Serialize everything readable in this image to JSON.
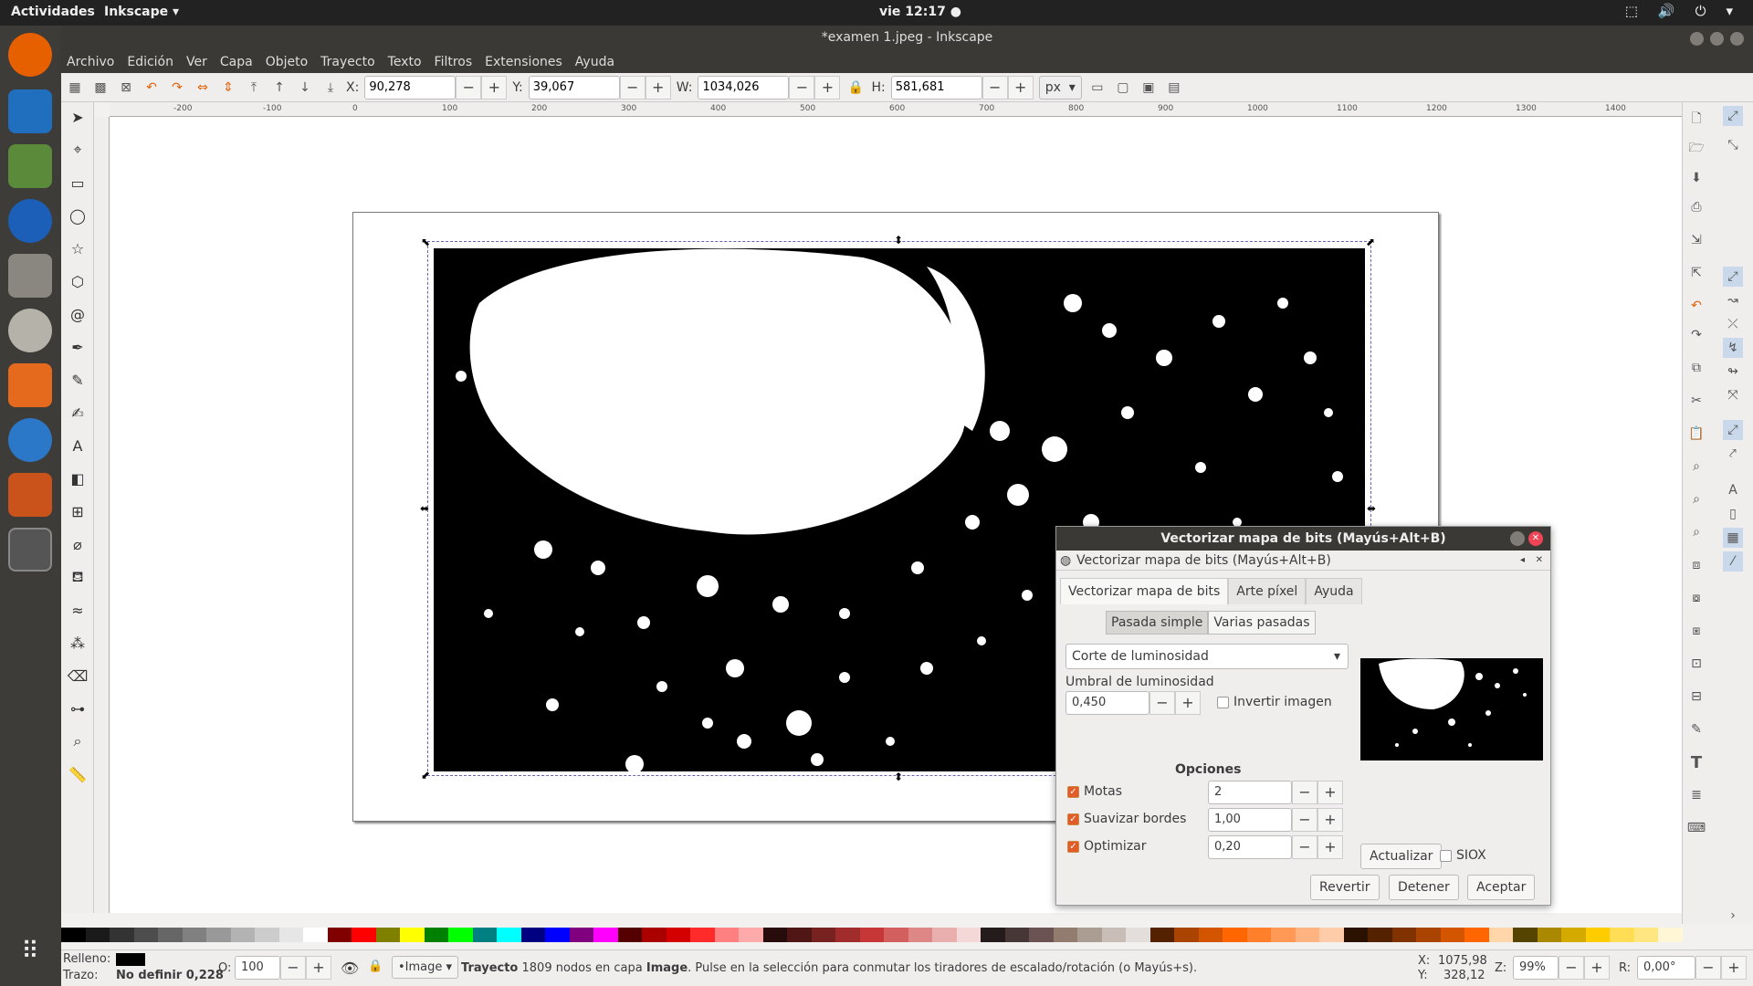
{
  "topbar": {
    "activities": "Actividades",
    "app": "Inkscape ▾",
    "clock": "vie 12:17 ●"
  },
  "window": {
    "title": "*examen 1.jpeg - Inkscape"
  },
  "menu": [
    "Archivo",
    "Edición",
    "Ver",
    "Capa",
    "Objeto",
    "Trayecto",
    "Texto",
    "Filtros",
    "Extensiones",
    "Ayuda"
  ],
  "controls": {
    "x_label": "X:",
    "x": "90,278",
    "y_label": "Y:",
    "y": "39,067",
    "w_label": "W:",
    "w": "1034,026",
    "h_label": "H:",
    "h": "581,681",
    "unit": "px"
  },
  "ruler": [
    "-200",
    "-100",
    "0",
    "100",
    "200",
    "300",
    "400",
    "500",
    "600",
    "700",
    "800",
    "900",
    "1000",
    "1100",
    "1200",
    "1300",
    "1400"
  ],
  "dialog": {
    "title": "Vectorizar mapa de bits (Mayús+Alt+B)",
    "subtitle": "Vectorizar mapa de bits (Mayús+Alt+B)",
    "tabs": [
      "Vectorizar mapa de bits",
      "Arte píxel",
      "Ayuda"
    ],
    "modes": [
      "Pasada simple",
      "Varias pasadas"
    ],
    "method": "Corte de luminosidad",
    "threshold_label": "Umbral de luminosidad",
    "threshold": "0,450",
    "invert_label": "Invertir imagen",
    "options_label": "Opciones",
    "speckles_label": "Motas",
    "speckles": "2",
    "smooth_label": "Suavizar bordes",
    "smooth": "1,00",
    "optimize_label": "Optimizar",
    "optimize": "0,20",
    "update": "Actualizar",
    "siox": "SIOX",
    "revert": "Revertir",
    "stop": "Detener",
    "ok": "Aceptar"
  },
  "status": {
    "fill_label": "Relleno:",
    "stroke_label": "Trazo:",
    "stroke_value": "No definir 0,228",
    "opacity_label": "O:",
    "opacity": "100",
    "layer": "•Image",
    "message_bold": "Trayecto",
    "message": " 1809 nodos en capa ",
    "message_layer": "Image",
    "message_rest": ". Pulse en la selección para conmutar los tiradores de escalado/rotación (o Mayús+s).",
    "cx_label": "X:",
    "cx": "1075,98",
    "cy_label": "Y:",
    "cy": "328,12",
    "zoom_label": "Z:",
    "zoom": "99%",
    "rot_label": "R:",
    "rot": "0,00°"
  },
  "palette": [
    "#000000",
    "#1a1a1a",
    "#333333",
    "#4d4d4d",
    "#666666",
    "#808080",
    "#999999",
    "#b3b3b3",
    "#cccccc",
    "#e6e6e6",
    "#ffffff",
    "#800000",
    "#ff0000",
    "#808000",
    "#ffff00",
    "#008000",
    "#00ff00",
    "#008080",
    "#00ffff",
    "#000080",
    "#0000ff",
    "#800080",
    "#ff00ff",
    "#550000",
    "#aa0000",
    "#d40000",
    "#ff2a2a",
    "#ff8080",
    "#ffaaaa",
    "#280b0b",
    "#501616",
    "#782121",
    "#a02c2c",
    "#c83737",
    "#d35f5f",
    "#de8787",
    "#e9afaf",
    "#f4d7d7",
    "#241c1c",
    "#483737",
    "#6c5353",
    "#917c6f",
    "#ac9d93",
    "#c8beb7",
    "#e3dedb",
    "#552200",
    "#aa4400",
    "#d45500",
    "#ff6600",
    "#ff7f2a",
    "#ff9955",
    "#ffb380",
    "#ffccaa",
    "#2b1100",
    "#552200",
    "#803300",
    "#aa4400",
    "#d45500",
    "#ff6600",
    "#ffd5aa",
    "#554400",
    "#aa8800",
    "#d4aa00",
    "#ffcc00",
    "#ffdd55",
    "#ffe680",
    "#fff6d5"
  ],
  "colors": {
    "accent": "#e25c2a",
    "dark": "#3a3935"
  }
}
